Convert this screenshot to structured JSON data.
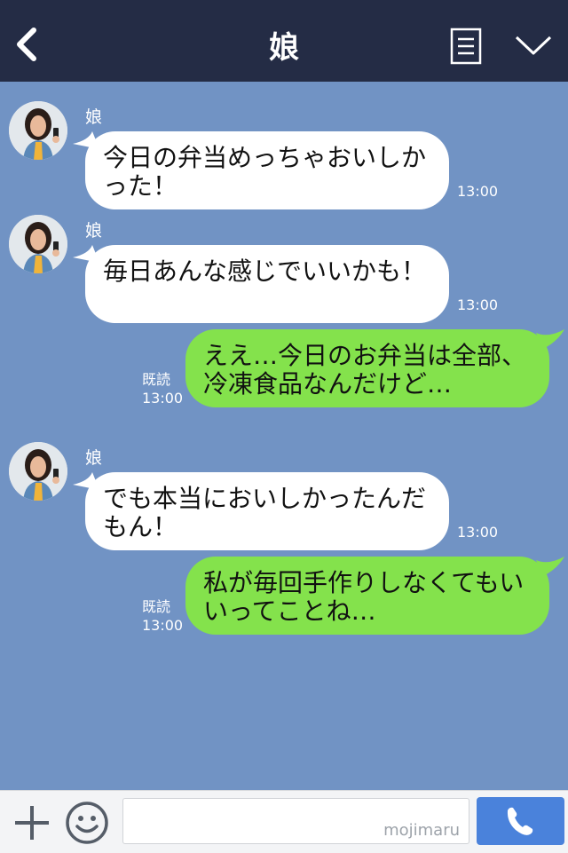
{
  "header": {
    "title": "娘"
  },
  "messages": [
    {
      "sender": "娘",
      "text": "今日の弁当めっちゃおいしかった！",
      "time": "13:00"
    },
    {
      "sender": "娘",
      "text": "毎日あんな感じでいいかも！",
      "time": "13:00"
    },
    {
      "read": "既読",
      "text": "ええ…今日のお弁当は全部、冷凍食品なんだけど…",
      "time": "13:00"
    },
    {
      "sender": "娘",
      "text": "でも本当においしかったんだもん！",
      "time": "13:00"
    },
    {
      "read": "既読",
      "text": "私が毎回手作りしなくてもいいってことね…",
      "time": "13:00"
    }
  ],
  "input": {
    "watermark": "mojimaru"
  },
  "colors": {
    "header_bg": "#242c45",
    "chat_bg": "#7193c4",
    "incoming_bubble": "#ffffff",
    "outgoing_bubble": "#84e24c",
    "call_button": "#4a82db"
  },
  "icons": [
    "back-icon",
    "memo-icon",
    "chevron-down-icon",
    "plus-icon",
    "smiley-icon",
    "phone-icon"
  ]
}
